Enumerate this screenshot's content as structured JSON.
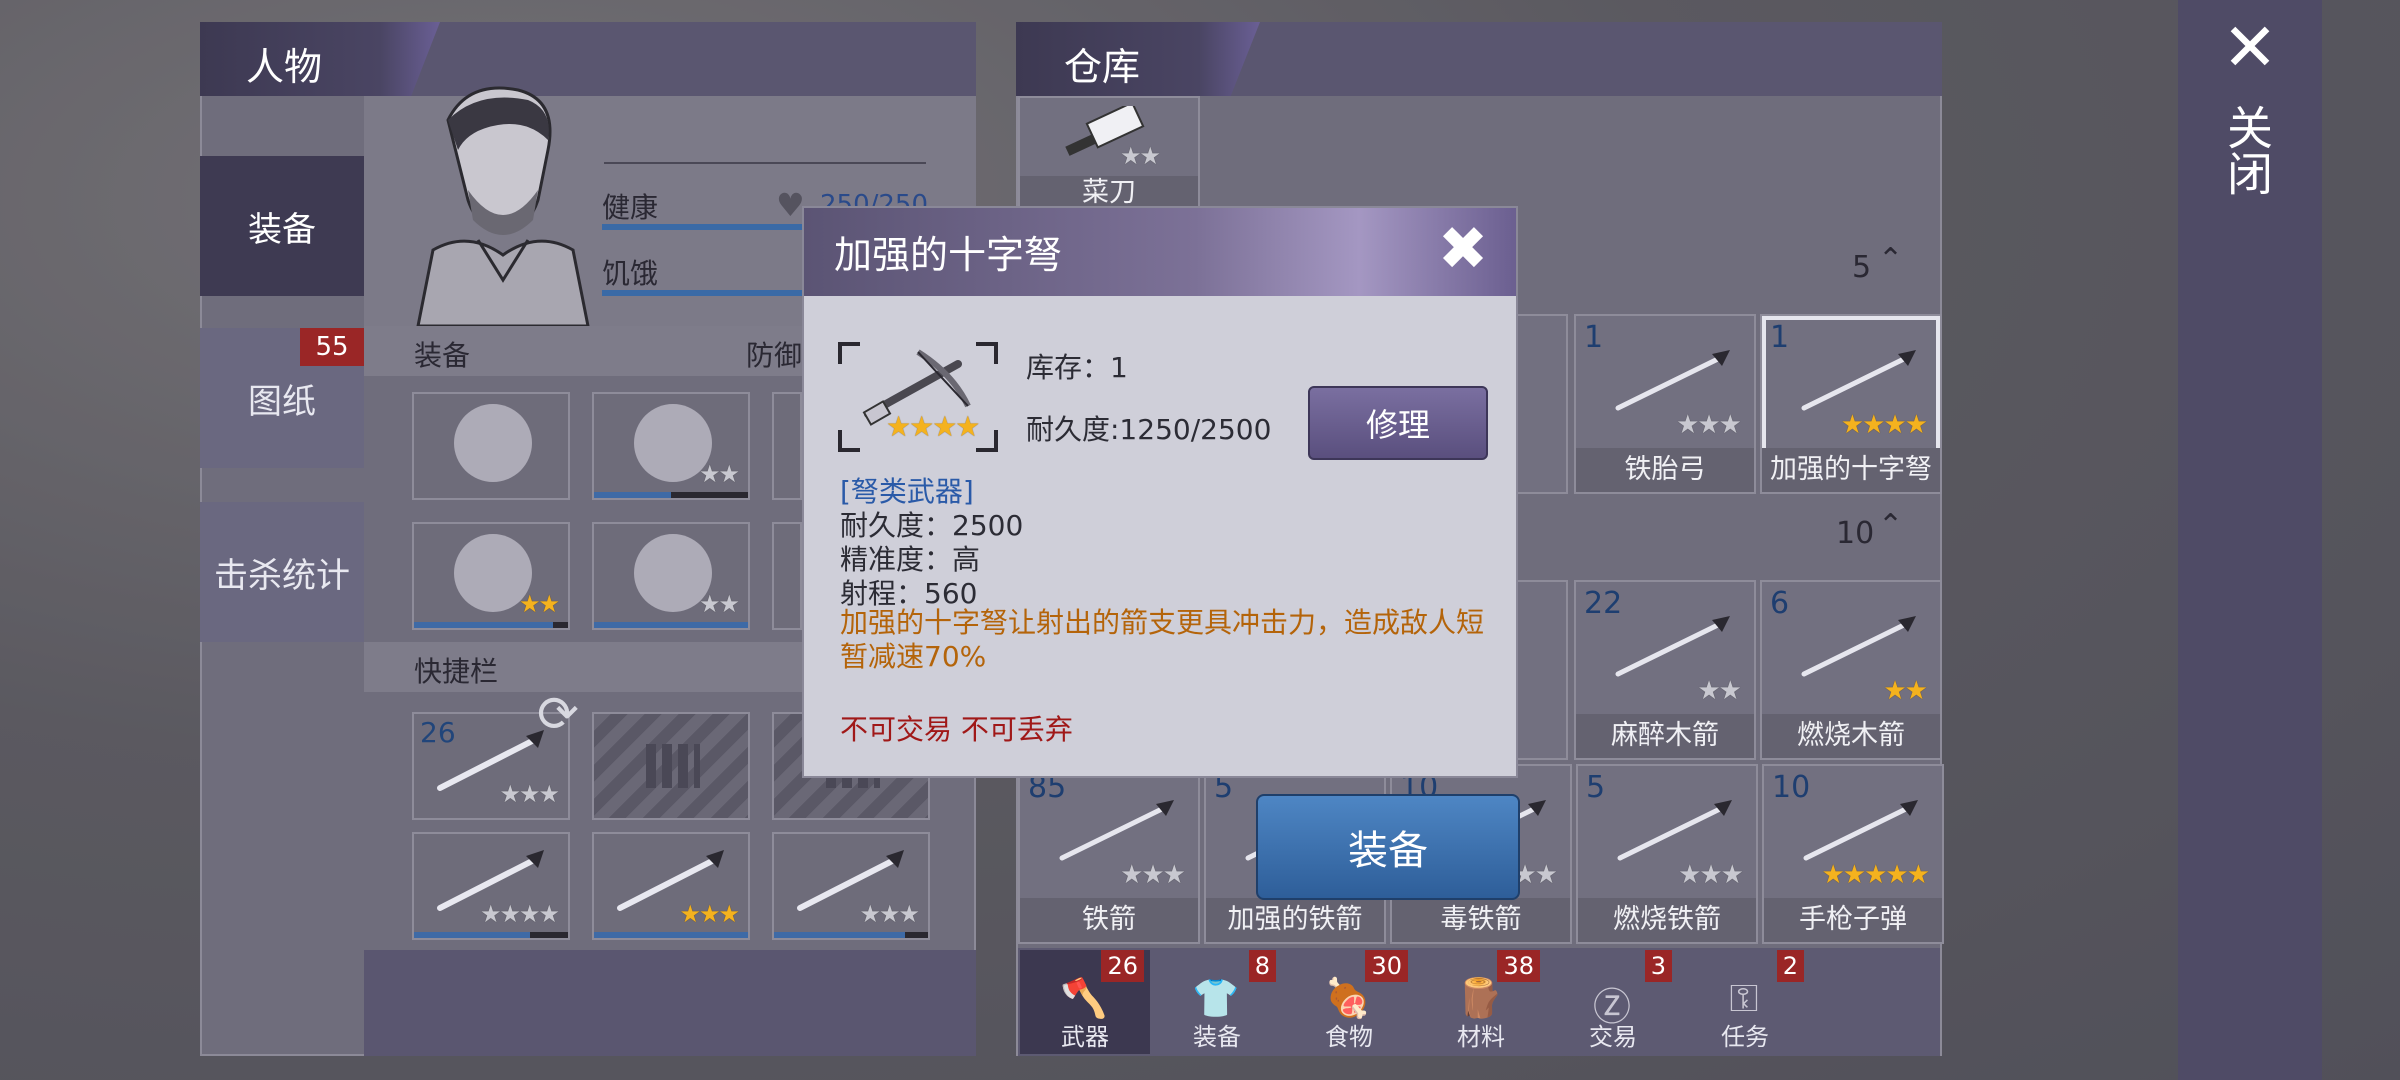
{
  "left_panel": {
    "title": "人物",
    "tabs": [
      {
        "label": "装备",
        "active": true
      },
      {
        "label": "图纸",
        "badge": "55"
      },
      {
        "label": "击杀统计"
      }
    ],
    "stats": [
      {
        "label": "健康",
        "value": "250/250"
      },
      {
        "label": "饥饿",
        "value": ""
      }
    ],
    "equip_section": "装备",
    "defense_label": "防御",
    "quickbar_section": "快捷栏",
    "equip_slots": [
      {
        "icon": "helmet-icon",
        "stars": 0,
        "durability": 0
      },
      {
        "icon": "shirt-icon",
        "stars": 2,
        "durability": 0.5
      },
      {
        "icon": "gloves-icon",
        "stars": 2,
        "durability": 0.9
      },
      {
        "icon": "pants-icon",
        "stars": 2,
        "durability": 1.0
      }
    ],
    "quick_slots": [
      {
        "icon": "spear-icon",
        "count": "26",
        "stars": 3,
        "gold": false
      },
      {
        "icon": "crossbow-icon",
        "count": "",
        "stars": 4,
        "gold": false,
        "durability": 0.75
      },
      {
        "icon": "machete-icon",
        "count": "",
        "stars": 3,
        "gold": true,
        "durability": 1.0
      },
      {
        "icon": "wrench-icon",
        "count": "",
        "stars": 3,
        "gold": false,
        "durability": 0.85
      }
    ]
  },
  "warehouse": {
    "title": "仓库",
    "top_item": {
      "name": "菜刀",
      "stars": 2
    },
    "section1_count": "5",
    "section2_count": "10",
    "row1": [
      {
        "name": "铁胎弓",
        "count": "1",
        "stars": 3,
        "gold": false
      },
      {
        "name": "加强的十字弩",
        "count": "1",
        "stars": 4,
        "gold": true,
        "selected": true
      }
    ],
    "row2": [
      {
        "name": "麻醉木箭",
        "count": "22",
        "stars": 2,
        "gold": false
      },
      {
        "name": "燃烧木箭",
        "count": "6",
        "stars": 2,
        "gold": true
      }
    ],
    "row3": [
      {
        "name": "铁箭",
        "count": "85",
        "stars": 3,
        "gold": false
      },
      {
        "name": "加强的铁箭",
        "count": "5",
        "stars": 3,
        "gold": false
      },
      {
        "name": "毒铁箭",
        "count": "10",
        "stars": 3,
        "gold": false
      },
      {
        "name": "燃烧铁箭",
        "count": "5",
        "stars": 3,
        "gold": false
      },
      {
        "name": "手枪子弹",
        "count": "10",
        "stars": 5,
        "gold": true
      }
    ],
    "bottom_tabs": [
      {
        "label": "武器",
        "badge": "26",
        "icon": "axe-icon",
        "active": true
      },
      {
        "label": "装备",
        "badge": "8",
        "icon": "shirt-icon"
      },
      {
        "label": "食物",
        "badge": "30",
        "icon": "meat-icon"
      },
      {
        "label": "材料",
        "badge": "38",
        "icon": "log-icon"
      },
      {
        "label": "交易",
        "badge": "3",
        "icon": "coin-icon"
      },
      {
        "label": "任务",
        "badge": "2",
        "icon": "key-icon"
      }
    ]
  },
  "popup": {
    "title": "加强的十字弩",
    "stock": "库存：1",
    "durability": "耐久度:1250/2500",
    "repair_label": "修理",
    "category": "[弩类武器]",
    "max_durability": "耐久度：2500",
    "accuracy": "精准度：高",
    "range": "射程：560",
    "description": "加强的十字弩让射出的箭支更具冲击力，造成敌人短暂减速70%",
    "restriction": "不可交易 不可丢弃",
    "stars": 4
  },
  "equip_button": "装备",
  "close": {
    "label": "关闭"
  },
  "colors": {
    "star_gold": "#f4b21e",
    "category_blue": "#2a5aa8",
    "description_orange": "#b4640a",
    "restriction_red": "#a01818",
    "equip_blue": "#3a70ae"
  }
}
